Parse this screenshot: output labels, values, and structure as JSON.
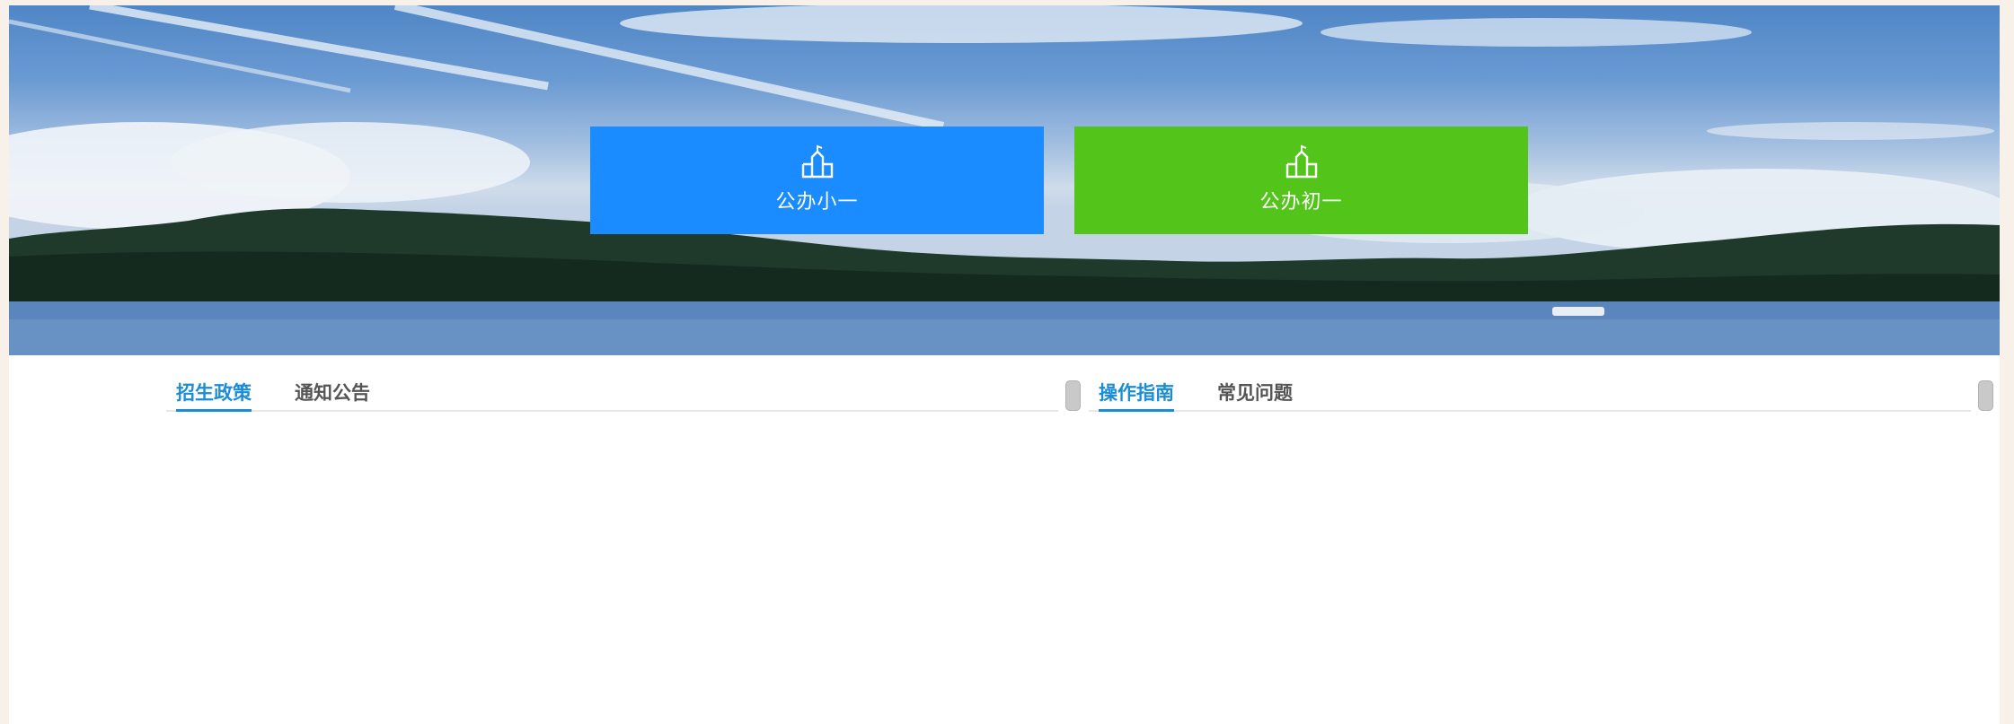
{
  "banner": {
    "entries": [
      {
        "label": "公办小一",
        "color": "#1a8cff",
        "icon": "school-building-icon"
      },
      {
        "label": "公办初一",
        "color": "#52c41a",
        "icon": "school-building-icon"
      }
    ]
  },
  "left_panel": {
    "tabs": [
      {
        "label": "招生政策",
        "active": true
      },
      {
        "label": "通知公告",
        "active": false
      }
    ]
  },
  "right_panel": {
    "tabs": [
      {
        "label": "操作指南",
        "active": true
      },
      {
        "label": "常见问题",
        "active": false
      }
    ]
  },
  "colors": {
    "accent": "#1a8cd8",
    "background": "#f8f1e9"
  }
}
